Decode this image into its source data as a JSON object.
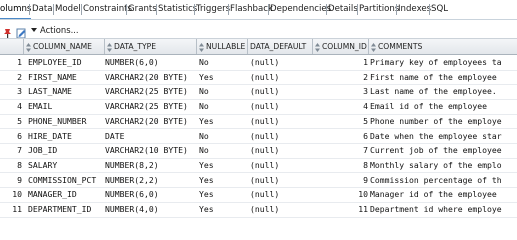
{
  "tabs": [
    {
      "label": "olumns",
      "active": true
    },
    {
      "label": "Data"
    },
    {
      "label": "Model"
    },
    {
      "label": "Constraints"
    },
    {
      "label": "Grants"
    },
    {
      "label": "Statistics"
    },
    {
      "label": "Triggers"
    },
    {
      "label": "Flashback"
    },
    {
      "label": "Dependencies"
    },
    {
      "label": "Details"
    },
    {
      "label": "Partitions"
    },
    {
      "label": "Indexes"
    },
    {
      "label": "SQL"
    }
  ],
  "toolbar": {
    "actions_label": "Actions...",
    "icons": [
      "pin-icon",
      "edit-icon"
    ]
  },
  "columns_header": [
    "",
    "COLUMN_NAME",
    "DATA_TYPE",
    "NULLABLE",
    "DATA_DEFAULT",
    "COLUMN_ID",
    "COMMENTS"
  ],
  "rows": [
    [
      "1",
      "EMPLOYEE_ID",
      "NUMBER(6,0)",
      "No",
      "(null)",
      "1",
      "Primary key of employees ta"
    ],
    [
      "2",
      "FIRST_NAME",
      "VARCHAR2(20 BYTE)",
      "Yes",
      "(null)",
      "2",
      "First name of the employee"
    ],
    [
      "3",
      "LAST_NAME",
      "VARCHAR2(25 BYTE)",
      "No",
      "(null)",
      "3",
      "Last name of the employee."
    ],
    [
      "4",
      "EMAIL",
      "VARCHAR2(25 BYTE)",
      "No",
      "(null)",
      "4",
      "Email id of the employee"
    ],
    [
      "5",
      "PHONE_NUMBER",
      "VARCHAR2(20 BYTE)",
      "Yes",
      "(null)",
      "5",
      "Phone number of the employe"
    ],
    [
      "6",
      "HIRE_DATE",
      "DATE",
      "No",
      "(null)",
      "6",
      "Date when the employee star"
    ],
    [
      "7",
      "JOB_ID",
      "VARCHAR2(10 BYTE)",
      "No",
      "(null)",
      "7",
      "Current job of the employee"
    ],
    [
      "8",
      "SALARY",
      "NUMBER(8,2)",
      "Yes",
      "(null)",
      "8",
      "Monthly salary of the emplo"
    ],
    [
      "9",
      "COMMISSION_PCT",
      "NUMBER(2,2)",
      "Yes",
      "(null)",
      "9",
      "Commission percentage of th"
    ],
    [
      "10",
      "MANAGER_ID",
      "NUMBER(6,0)",
      "Yes",
      "(null)",
      "10",
      "Manager id of the employee"
    ],
    [
      "11",
      "DEPARTMENT_ID",
      "NUMBER(4,0)",
      "Yes",
      "(null)",
      "11",
      "Department id where employe"
    ]
  ],
  "colors": {
    "selected_tab_underline": "#4b89c8",
    "header_bg": "#e9edf1"
  }
}
